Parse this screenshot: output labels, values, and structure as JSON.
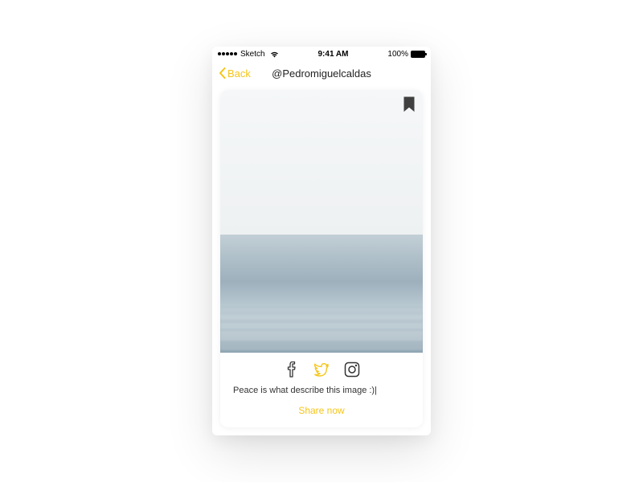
{
  "status_bar": {
    "carrier": "Sketch",
    "time": "9:41 AM",
    "battery_pct": "100%"
  },
  "nav": {
    "back_label": "Back",
    "title": "@Pedromiguelcaldas"
  },
  "post": {
    "caption": "Peace is what describe this image :)",
    "share_label": "Share now"
  },
  "colors": {
    "accent": "#F5C518"
  }
}
